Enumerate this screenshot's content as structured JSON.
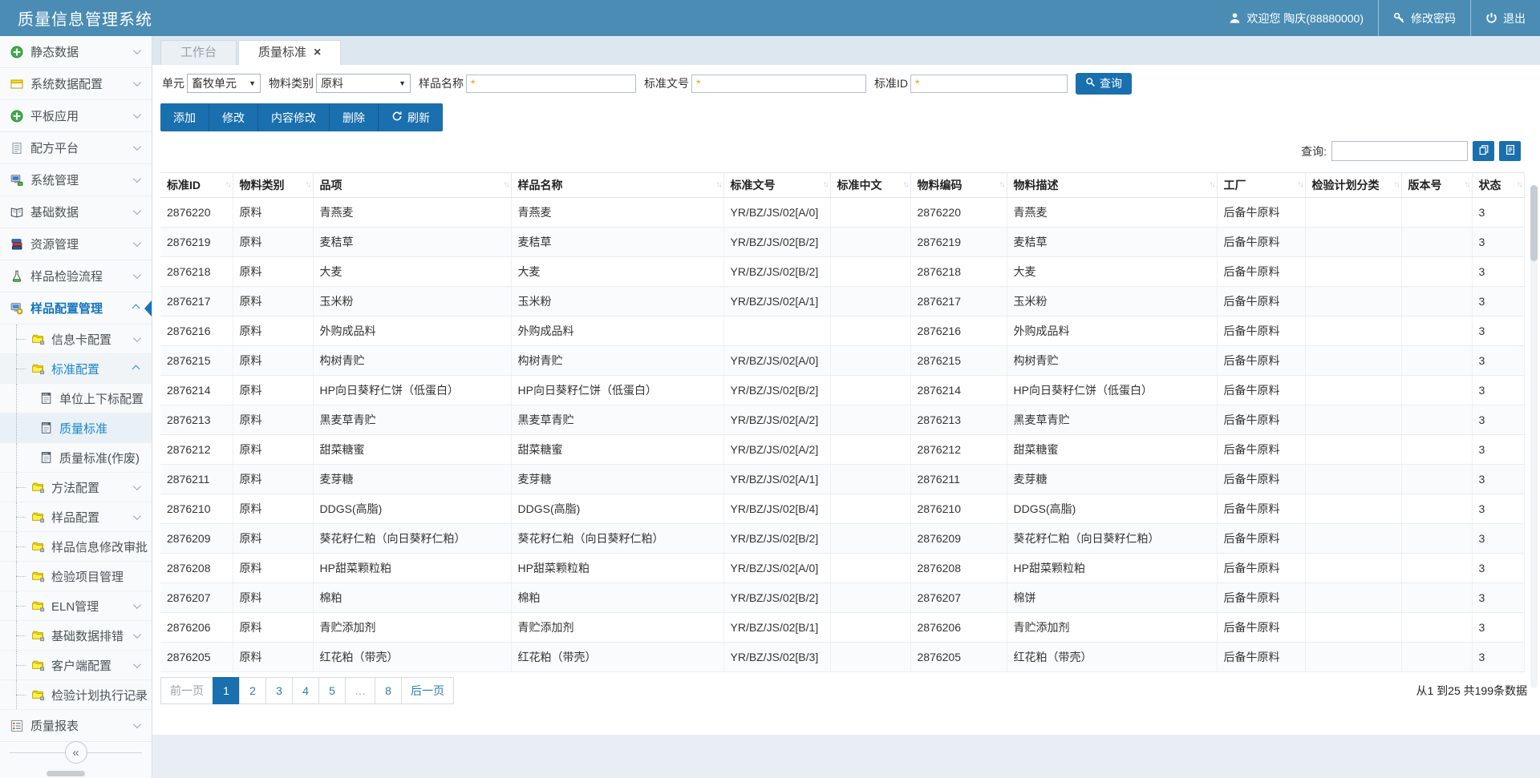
{
  "app": {
    "title": "质量信息管理系统"
  },
  "header": {
    "welcome": "欢迎您 陶庆(88880000)",
    "change_password": "修改密码",
    "logout": "退出",
    "icons": {
      "user": "person-icon",
      "password": "key-icon",
      "logout": "power-icon"
    }
  },
  "tabs": [
    {
      "label": "工作台",
      "active": false
    },
    {
      "label": "质量标准",
      "active": true,
      "close_icon": "×"
    }
  ],
  "sidebar": {
    "collapse_label": "«",
    "items": [
      {
        "label": "静态数据",
        "icon": "plus-circle-icon",
        "chevron": "down"
      },
      {
        "label": "系统数据配置",
        "icon": "window-icon",
        "chevron": "down"
      },
      {
        "label": "平板应用",
        "icon": "plus-circle-icon",
        "chevron": "down"
      },
      {
        "label": "配方平台",
        "icon": "document-icon",
        "chevron": "down"
      },
      {
        "label": "系统管理",
        "icon": "computer-icon",
        "chevron": "down"
      },
      {
        "label": "基础数据",
        "icon": "book-icon",
        "chevron": "down"
      },
      {
        "label": "资源管理",
        "icon": "books-icon",
        "chevron": "down"
      },
      {
        "label": "样品检验流程",
        "icon": "flask-icon",
        "chevron": "down"
      },
      {
        "label": "样品配置管理",
        "icon": "config-icon",
        "chevron": "up",
        "expanded": true,
        "selected": true,
        "children": [
          {
            "label": "信息卡配置",
            "icon": "folder-icon",
            "chevron": "down"
          },
          {
            "label": "标准配置",
            "icon": "folder-icon",
            "chevron": "up",
            "expanded": true,
            "children": [
              {
                "label": "单位上下标配置",
                "icon": "page-icon"
              },
              {
                "label": "质量标准",
                "icon": "page-icon",
                "selected": true
              },
              {
                "label": "质量标准(作废)",
                "icon": "page-icon"
              }
            ]
          },
          {
            "label": "方法配置",
            "icon": "folder-icon",
            "chevron": "down"
          },
          {
            "label": "样品配置",
            "icon": "folder-icon",
            "chevron": "down"
          },
          {
            "label": "样品信息修改审批",
            "icon": "folder-icon",
            "chevron": "down"
          },
          {
            "label": "检验项目管理",
            "icon": "folder-icon"
          },
          {
            "label": "ELN管理",
            "icon": "folder-icon",
            "chevron": "down"
          },
          {
            "label": "基础数据排错",
            "icon": "folder-icon",
            "chevron": "down"
          },
          {
            "label": "客户端配置",
            "icon": "folder-icon",
            "chevron": "down"
          },
          {
            "label": "检验计划执行记录",
            "icon": "folder-icon",
            "chevron": "down"
          }
        ]
      },
      {
        "label": "质量报表",
        "icon": "report-icon",
        "chevron": "down"
      }
    ]
  },
  "filters": {
    "unit_label": "单元",
    "unit_value": "畜牧单元",
    "material_type_label": "物料类别",
    "material_type_value": "原料",
    "sample_name_label": "样品名称",
    "sample_name_value": "*",
    "standard_no_label": "标准文号",
    "standard_no_value": "*",
    "standard_id_label": "标准ID",
    "standard_id_value": "*",
    "search_button": "查询",
    "search_icon": "magnifier-icon"
  },
  "toolbar": {
    "add": "添加",
    "edit": "修改",
    "content_edit": "内容修改",
    "delete": "删除",
    "refresh": "刷新",
    "refresh_icon": "refresh-icon"
  },
  "quick_search": {
    "label": "查询:",
    "buttons": [
      "copy-pages-icon",
      "export-file-icon"
    ]
  },
  "table": {
    "columns": [
      "标准ID",
      "物料类别",
      "品项",
      "样品名称",
      "标准文号",
      "标准中文",
      "物料编码",
      "物料描述",
      "工厂",
      "检验计划分类",
      "版本号",
      "状态"
    ],
    "rows": [
      [
        "2876220",
        "原料",
        "青燕麦",
        "青燕麦",
        "YR/BZ/JS/02[A/0]",
        "",
        "2876220",
        "青燕麦",
        "后备牛原料",
        "",
        "",
        "3"
      ],
      [
        "2876219",
        "原料",
        "麦秸草",
        "麦秸草",
        "YR/BZ/JS/02[B/2]",
        "",
        "2876219",
        "麦秸草",
        "后备牛原料",
        "",
        "",
        "3"
      ],
      [
        "2876218",
        "原料",
        "大麦",
        "大麦",
        "YR/BZ/JS/02[B/2]",
        "",
        "2876218",
        "大麦",
        "后备牛原料",
        "",
        "",
        "3"
      ],
      [
        "2876217",
        "原料",
        "玉米粉",
        "玉米粉",
        "YR/BZ/JS/02[A/1]",
        "",
        "2876217",
        "玉米粉",
        "后备牛原料",
        "",
        "",
        "3"
      ],
      [
        "2876216",
        "原料",
        "外购成品料",
        "外购成品料",
        "",
        "",
        "2876216",
        "外购成品料",
        "后备牛原料",
        "",
        "",
        "3"
      ],
      [
        "2876215",
        "原料",
        "构树青贮",
        "构树青贮",
        "YR/BZ/JS/02[A/0]",
        "",
        "2876215",
        "构树青贮",
        "后备牛原料",
        "",
        "",
        "3"
      ],
      [
        "2876214",
        "原料",
        "HP向日葵籽仁饼（低蛋白）",
        "HP向日葵籽仁饼（低蛋白）",
        "YR/BZ/JS/02[B/2]",
        "",
        "2876214",
        "HP向日葵籽仁饼（低蛋白）",
        "后备牛原料",
        "",
        "",
        "3"
      ],
      [
        "2876213",
        "原料",
        "黑麦草青贮",
        "黑麦草青贮",
        "YR/BZ/JS/02[A/2]",
        "",
        "2876213",
        "黑麦草青贮",
        "后备牛原料",
        "",
        "",
        "3"
      ],
      [
        "2876212",
        "原料",
        "甜菜糖蜜",
        "甜菜糖蜜",
        "YR/BZ/JS/02[A/2]",
        "",
        "2876212",
        "甜菜糖蜜",
        "后备牛原料",
        "",
        "",
        "3"
      ],
      [
        "2876211",
        "原料",
        "麦芽糖",
        "麦芽糖",
        "YR/BZ/JS/02[A/1]",
        "",
        "2876211",
        "麦芽糖",
        "后备牛原料",
        "",
        "",
        "3"
      ],
      [
        "2876210",
        "原料",
        "DDGS(高脂)",
        "DDGS(高脂)",
        "YR/BZ/JS/02[B/4]",
        "",
        "2876210",
        "DDGS(高脂)",
        "后备牛原料",
        "",
        "",
        "3"
      ],
      [
        "2876209",
        "原料",
        "葵花籽仁粕（向日葵籽仁粕）",
        "葵花籽仁粕（向日葵籽仁粕）",
        "YR/BZ/JS/02[B/2]",
        "",
        "2876209",
        "葵花籽仁粕（向日葵籽仁粕）",
        "后备牛原料",
        "",
        "",
        "3"
      ],
      [
        "2876208",
        "原料",
        "HP甜菜颗粒粕",
        "HP甜菜颗粒粕",
        "YR/BZ/JS/02[A/0]",
        "",
        "2876208",
        "HP甜菜颗粒粕",
        "后备牛原料",
        "",
        "",
        "3"
      ],
      [
        "2876207",
        "原料",
        "棉粕",
        "棉粕",
        "YR/BZ/JS/02[B/2]",
        "",
        "2876207",
        "棉饼",
        "后备牛原料",
        "",
        "",
        "3"
      ],
      [
        "2876206",
        "原料",
        "青贮添加剂",
        "青贮添加剂",
        "YR/BZ/JS/02[B/1]",
        "",
        "2876206",
        "青贮添加剂",
        "后备牛原料",
        "",
        "",
        "3"
      ],
      [
        "2876205",
        "原料",
        "红花粕（带壳）",
        "红花粕（带壳）",
        "YR/BZ/JS/02[B/3]",
        "",
        "2876205",
        "红花粕（带壳）",
        "后备牛原料",
        "",
        "",
        "3"
      ]
    ]
  },
  "pagination": {
    "prev": "前一页",
    "pages": [
      "1",
      "2",
      "3",
      "4",
      "5",
      "…",
      "8"
    ],
    "active_page": "1",
    "next": "后一页"
  },
  "status": {
    "record_info": "从1 到25 共199条数据"
  },
  "colors": {
    "header_blue": "#4a8cb4",
    "primary_blue": "#1a6fae",
    "link_blue": "#1a87c9",
    "selected_text_blue": "#1374bd",
    "asterisk_orange": "#f59a00",
    "panel_bg": "#ffffff",
    "page_bg": "#e9eef4"
  }
}
